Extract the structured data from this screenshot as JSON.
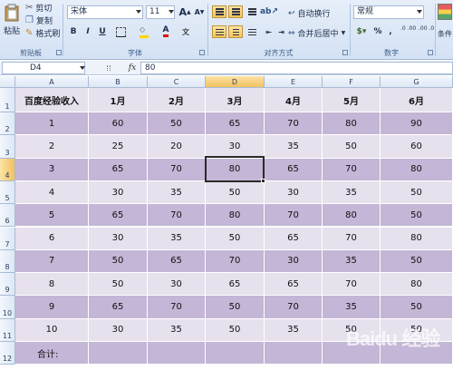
{
  "ribbon": {
    "clipboard": {
      "paste_label": "粘贴",
      "cut_label": "剪切",
      "copy_label": "复制",
      "format_painter_label": "格式刷",
      "group_label": "剪贴板"
    },
    "font": {
      "font_name": "宋体",
      "font_size": "11",
      "grow_label": "A",
      "shrink_label": "A",
      "bold": "B",
      "italic": "I",
      "underline": "U",
      "font_color_glyph": "A",
      "group_label": "字体"
    },
    "alignment": {
      "wrap_text_label": "自动换行",
      "merge_center_label": "合并后居中",
      "group_label": "对齐方式"
    },
    "number": {
      "format_value": "常规",
      "percent_label": "%",
      "comma_label": ",",
      "increase_decimal_label": ".0 .00",
      "decrease_decimal_label": ".00 .0",
      "group_label": "数字"
    },
    "styles": {
      "conditional_label": "条件"
    }
  },
  "formula_bar": {
    "name_box": "D4",
    "fx_label": "fx",
    "value": "80"
  },
  "columns": [
    "A",
    "B",
    "C",
    "D",
    "E",
    "F",
    "G"
  ],
  "selected_column": "D",
  "selected_row": "4",
  "row_numbers": [
    "1",
    "2",
    "3",
    "4",
    "5",
    "6",
    "7",
    "8",
    "9",
    "10",
    "11",
    "12"
  ],
  "table": {
    "headers": [
      "百度经验收入",
      "1月",
      "2月",
      "3月",
      "4月",
      "5月",
      "6月"
    ],
    "rows": [
      [
        "1",
        "60",
        "50",
        "65",
        "70",
        "80",
        "90"
      ],
      [
        "2",
        "25",
        "20",
        "30",
        "35",
        "50",
        "60"
      ],
      [
        "3",
        "65",
        "70",
        "80",
        "65",
        "70",
        "80"
      ],
      [
        "4",
        "30",
        "35",
        "50",
        "30",
        "35",
        "50"
      ],
      [
        "5",
        "65",
        "70",
        "80",
        "70",
        "80",
        "50"
      ],
      [
        "6",
        "30",
        "35",
        "50",
        "65",
        "70",
        "80"
      ],
      [
        "7",
        "50",
        "65",
        "70",
        "30",
        "35",
        "50"
      ],
      [
        "8",
        "50",
        "30",
        "65",
        "65",
        "70",
        "80"
      ],
      [
        "9",
        "65",
        "70",
        "50",
        "70",
        "35",
        "50"
      ],
      [
        "10",
        "30",
        "35",
        "50",
        "35",
        "50",
        "50"
      ]
    ],
    "total_label": "合计:"
  },
  "watermark": {
    "text": "Baidu 经验"
  },
  "colors": {
    "band_light": "#e7e1ee",
    "band_dark": "#c4b6d6",
    "ribbon_top": "#e6eef9",
    "selection_header": "#f2c15e"
  }
}
